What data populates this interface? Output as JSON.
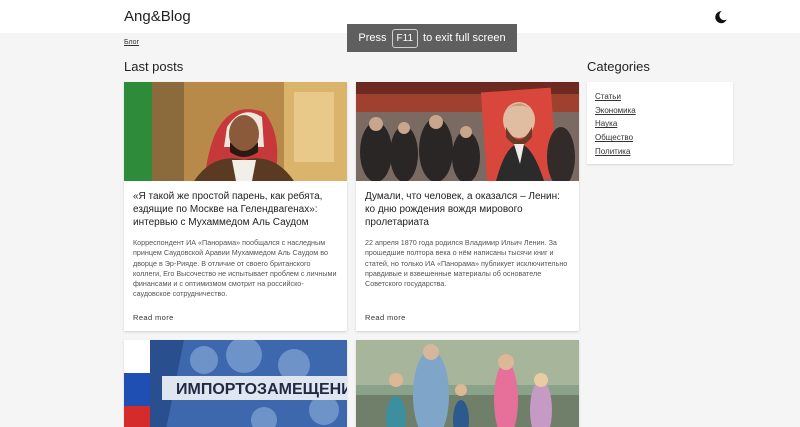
{
  "header": {
    "brand": "Ang&Blog",
    "theme_icon": "moon-icon"
  },
  "fullscreen_notice": {
    "before": "Press",
    "key": "F11",
    "after": "to exit full screen"
  },
  "breadcrumb": {
    "label": "Блог"
  },
  "main": {
    "title": "Last posts",
    "posts": [
      {
        "title": "«Я такой же простой парень, как ребята, ездящие по Москве на Гелендвагенах»: интервью с Мухаммедом Аль Саудом",
        "excerpt": "Корреспондент ИА «Панорама» пообщался с наследным принцем Саудовской Аравии Мухаммедом Аль Саудом во дворце в Эр-Рияде. В отличие от своего британского коллеги, Его Высочество не испытывает проблем с личными финансами и с оптимизмом смотрит на российско-саудовское сотрудничество.",
        "read_more": "Read more"
      },
      {
        "title": "Думали, что человек, а оказался – Ленин: ко дню рождения вождя мирового пролетариата",
        "excerpt": "22 апреля 1870 года родился Владимир Ильич Ленин. За прошедшие полтора века о нём написаны тысячи книг и статей, но только ИА «Панорама» публикует исключительно правдивые и взвешенные материалы об основателе Советского государства.",
        "read_more": "Read more"
      },
      {
        "image_text": "ИМПОРТОЗАМЕЩЕНИ"
      },
      {}
    ]
  },
  "sidebar": {
    "title": "Categories",
    "categories": [
      "Статьи",
      "Экономика",
      "Наука",
      "Общество",
      "Политика"
    ]
  },
  "colors": {
    "background": "#f5f5f5",
    "card": "#ffffff",
    "toast": "#5f5f5f"
  }
}
